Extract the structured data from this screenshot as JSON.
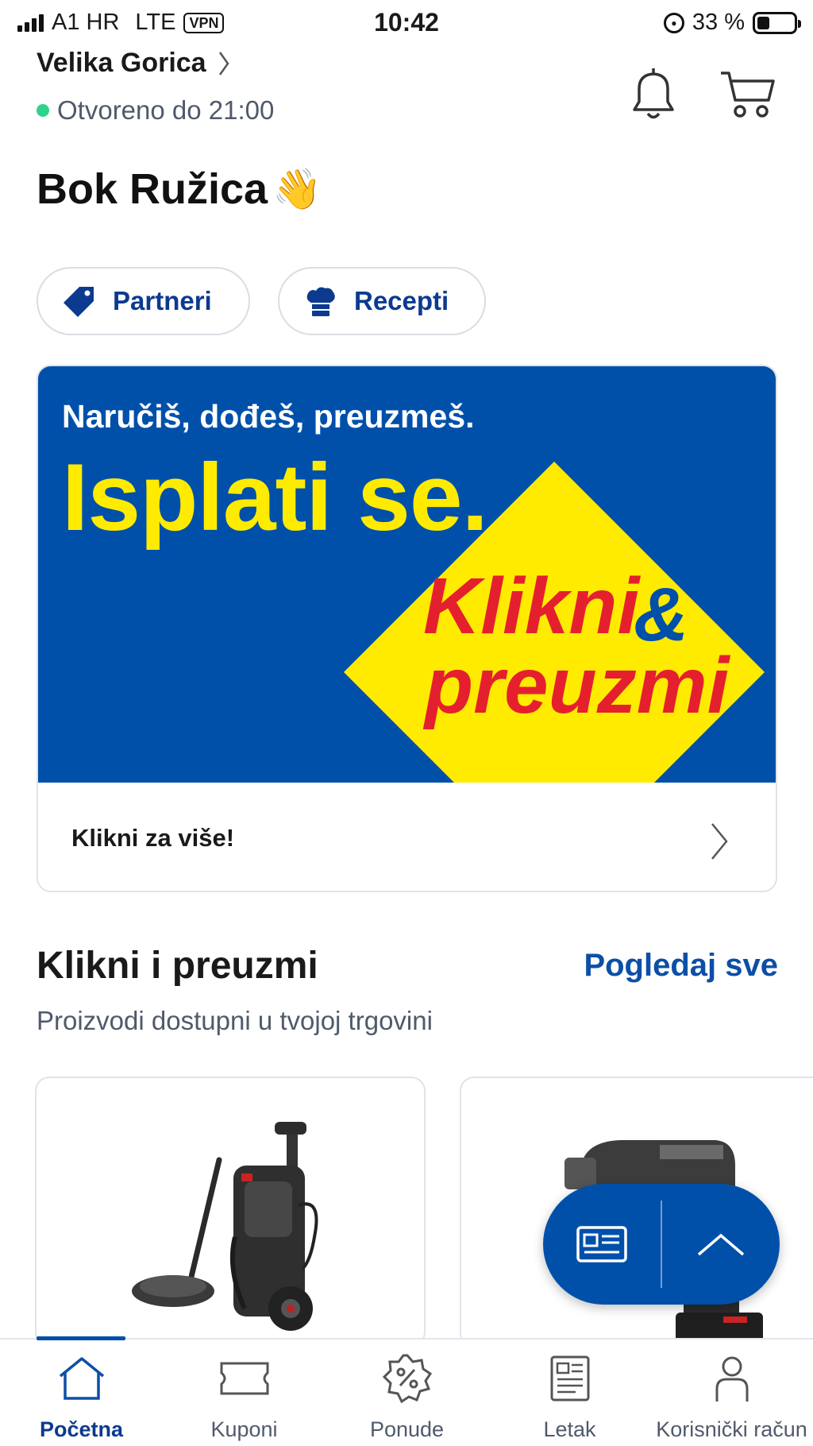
{
  "status_bar": {
    "carrier": "A1 HR",
    "network": "LTE",
    "vpn": "VPN",
    "time": "10:42",
    "battery_text": "33 %",
    "battery_level": 0.33
  },
  "header": {
    "store_name": "Velika Gorica",
    "open_status": "Otvoreno do 21:00",
    "greeting": "Bok Ružica",
    "greeting_emoji": "👋"
  },
  "quick_links": [
    {
      "label": "Partneri",
      "icon": "tag-icon"
    },
    {
      "label": "Recepti",
      "icon": "chef-hat-icon"
    }
  ],
  "banner": {
    "subtitle": "Naručiš, dođeš, preuzmeš.",
    "headline": "Isplati se.",
    "badge_line1": "Klikni",
    "badge_amp": "&",
    "badge_line2": "preuzmi",
    "cta": "Klikni za više!",
    "colors": {
      "blue": "#0050aa",
      "yellow": "#ffeb00",
      "red": "#e5202e"
    }
  },
  "section": {
    "title": "Klikni i preuzmi",
    "link": "Pogledaj sve",
    "subtitle": "Proizvodi dostupni u tvojoj trgovini"
  },
  "products": [
    {
      "image": "pressure-washer-image"
    },
    {
      "image": "power-tool-image"
    }
  ],
  "bottom_nav": [
    {
      "label": "Početna",
      "icon": "home-icon",
      "active": true
    },
    {
      "label": "Kuponi",
      "icon": "coupon-icon",
      "active": false
    },
    {
      "label": "Ponude",
      "icon": "discount-badge-icon",
      "active": false
    },
    {
      "label": "Letak",
      "icon": "flyer-icon",
      "active": false
    },
    {
      "label": "Korisnički račun",
      "icon": "user-icon",
      "active": false
    }
  ]
}
